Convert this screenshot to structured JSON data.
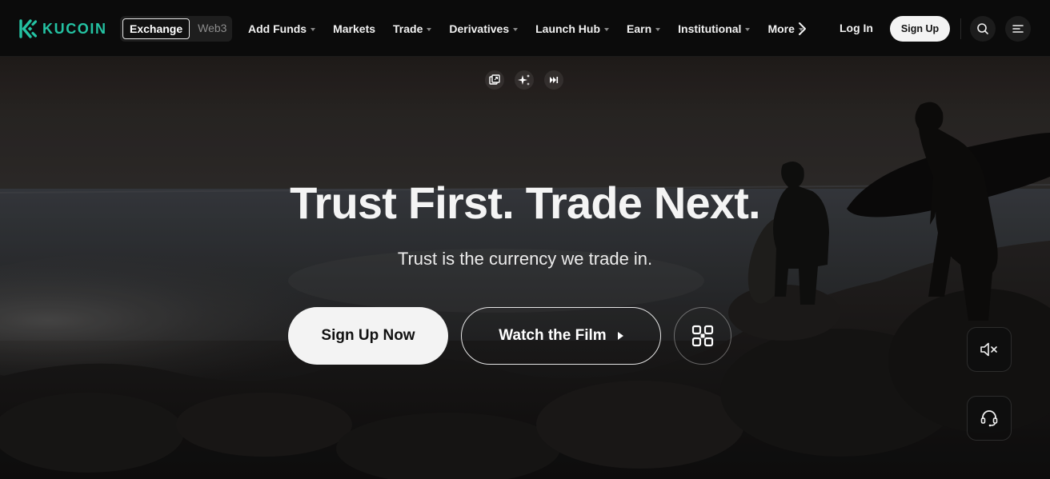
{
  "brand": {
    "name": "KUCOIN",
    "accent": "#24c3a3"
  },
  "switch": {
    "exchange": "Exchange",
    "web3": "Web3"
  },
  "nav": [
    {
      "label": "Add Funds",
      "dropdown": true
    },
    {
      "label": "Markets",
      "dropdown": false
    },
    {
      "label": "Trade",
      "dropdown": true
    },
    {
      "label": "Derivatives",
      "dropdown": true
    },
    {
      "label": "Launch Hub",
      "dropdown": true
    },
    {
      "label": "Earn",
      "dropdown": true
    },
    {
      "label": "Institutional",
      "dropdown": true
    },
    {
      "label": "More",
      "dropdown": true
    }
  ],
  "header": {
    "login": "Log In",
    "signup": "Sign Up",
    "icons": [
      "chevron-right-icon",
      "search-icon",
      "menu-icon"
    ]
  },
  "media": {
    "icons": [
      "picture-in-picture-icon",
      "sparkle-icon",
      "skip-forward-icon"
    ]
  },
  "hero": {
    "title": "Trust First. Trade Next.",
    "subtitle": "Trust is the currency we trade in.",
    "primary_cta": "Sign Up Now",
    "film_cta": "Watch the Film",
    "qr_icon": "qr-code-icon"
  },
  "side": {
    "icons": [
      "mute-icon",
      "support-headset-icon"
    ]
  }
}
